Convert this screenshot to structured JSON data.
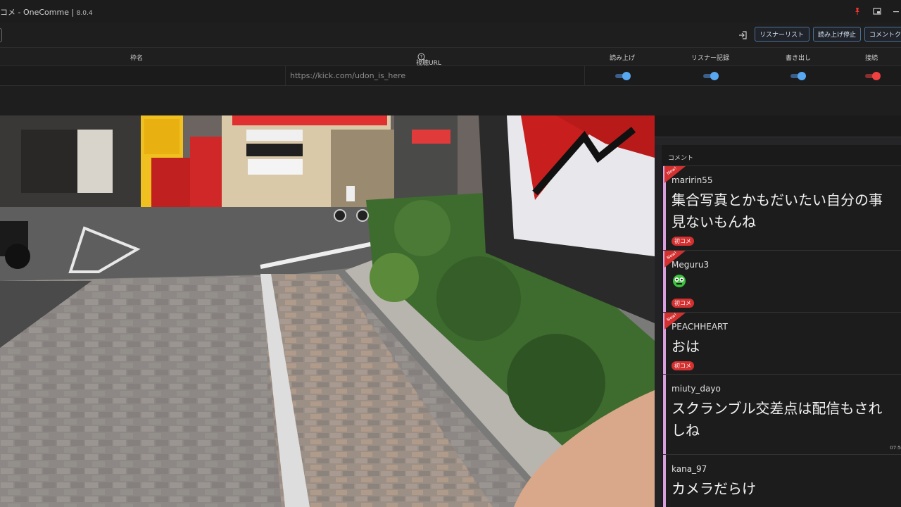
{
  "window": {
    "title": "コメ - OneComme | ",
    "version": "8.0.4"
  },
  "toolbar": {
    "listener_list": "リスナーリスト",
    "stop_reading": "読み上げ停止",
    "comment": "コメントク"
  },
  "table": {
    "headers": {
      "frame": "枠名",
      "url": "視聴URL",
      "read": "読み上げ",
      "record": "リスナー記録",
      "export": "書き出し",
      "connect": "接続"
    },
    "row": {
      "url": "https://kick.com/udon_is_here"
    }
  },
  "comment_panel": {
    "header": "コメント",
    "items": [
      {
        "user": "maririn55",
        "lines": [
          "集合写真とかもだいたい自分の事",
          "見ないもんね"
        ],
        "badge": "初コメ",
        "new": true
      },
      {
        "user": "Meguru3",
        "lines": [],
        "badge": "初コメ",
        "new": true,
        "emoji": "green-face-icon"
      },
      {
        "user": "PEACHHEART",
        "lines": [
          "おは"
        ],
        "badge": "初コメ",
        "new": true
      },
      {
        "user": "miuty_dayo",
        "lines": [
          "スクランブル交差点は配信もされ",
          "しね"
        ],
        "time": "07:5"
      },
      {
        "user": "kana_97",
        "lines": [
          "カメラだらけ"
        ]
      }
    ]
  },
  "colors": {
    "accent_blue": "#58a8f0",
    "connect_red": "#f04040",
    "comment_stripe": "#d9a0e0",
    "badge_red": "#d43030"
  }
}
